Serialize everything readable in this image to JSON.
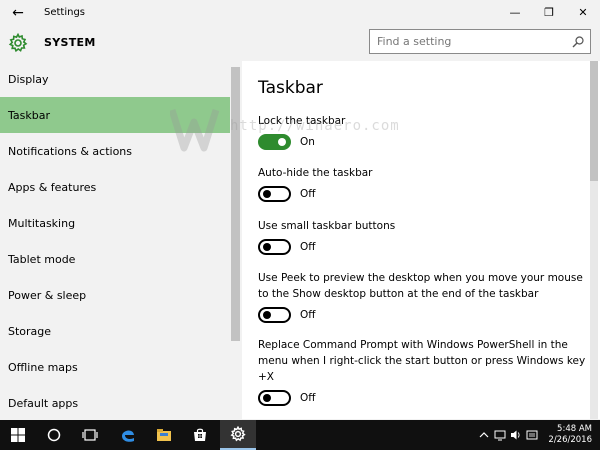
{
  "window": {
    "title": "Settings",
    "back_glyph": "←",
    "minimize_glyph": "—",
    "maximize_glyph": "❐",
    "close_glyph": "✕"
  },
  "header": {
    "section": "SYSTEM",
    "search_placeholder": "Find a setting"
  },
  "sidebar": {
    "items": [
      {
        "label": "Display"
      },
      {
        "label": "Taskbar"
      },
      {
        "label": "Notifications & actions"
      },
      {
        "label": "Apps & features"
      },
      {
        "label": "Multitasking"
      },
      {
        "label": "Tablet mode"
      },
      {
        "label": "Power & sleep"
      },
      {
        "label": "Storage"
      },
      {
        "label": "Offline maps"
      },
      {
        "label": "Default apps"
      }
    ],
    "active": "Taskbar"
  },
  "main": {
    "title": "Taskbar",
    "settings": [
      {
        "label": "Lock the taskbar",
        "state": "On"
      },
      {
        "label": "Auto-hide the taskbar",
        "state": "Off"
      },
      {
        "label": "Use small taskbar buttons",
        "state": "Off"
      },
      {
        "label": "Use Peek to preview the desktop when you move your mouse to the Show desktop button at the end of the taskbar",
        "state": "Off"
      },
      {
        "label": "Replace Command Prompt with Windows PowerShell in the menu when I right-click the start button or press Windows key +X",
        "state": "Off"
      }
    ]
  },
  "watermark": {
    "url": "http://winaero.com"
  },
  "taskbar": {
    "time": "5:48 AM",
    "date": "2/26/2016"
  },
  "colors": {
    "accent_active_nav": "#8fc98d",
    "toggle_on": "#2e8b2e",
    "taskbar_bg": "#101010"
  }
}
